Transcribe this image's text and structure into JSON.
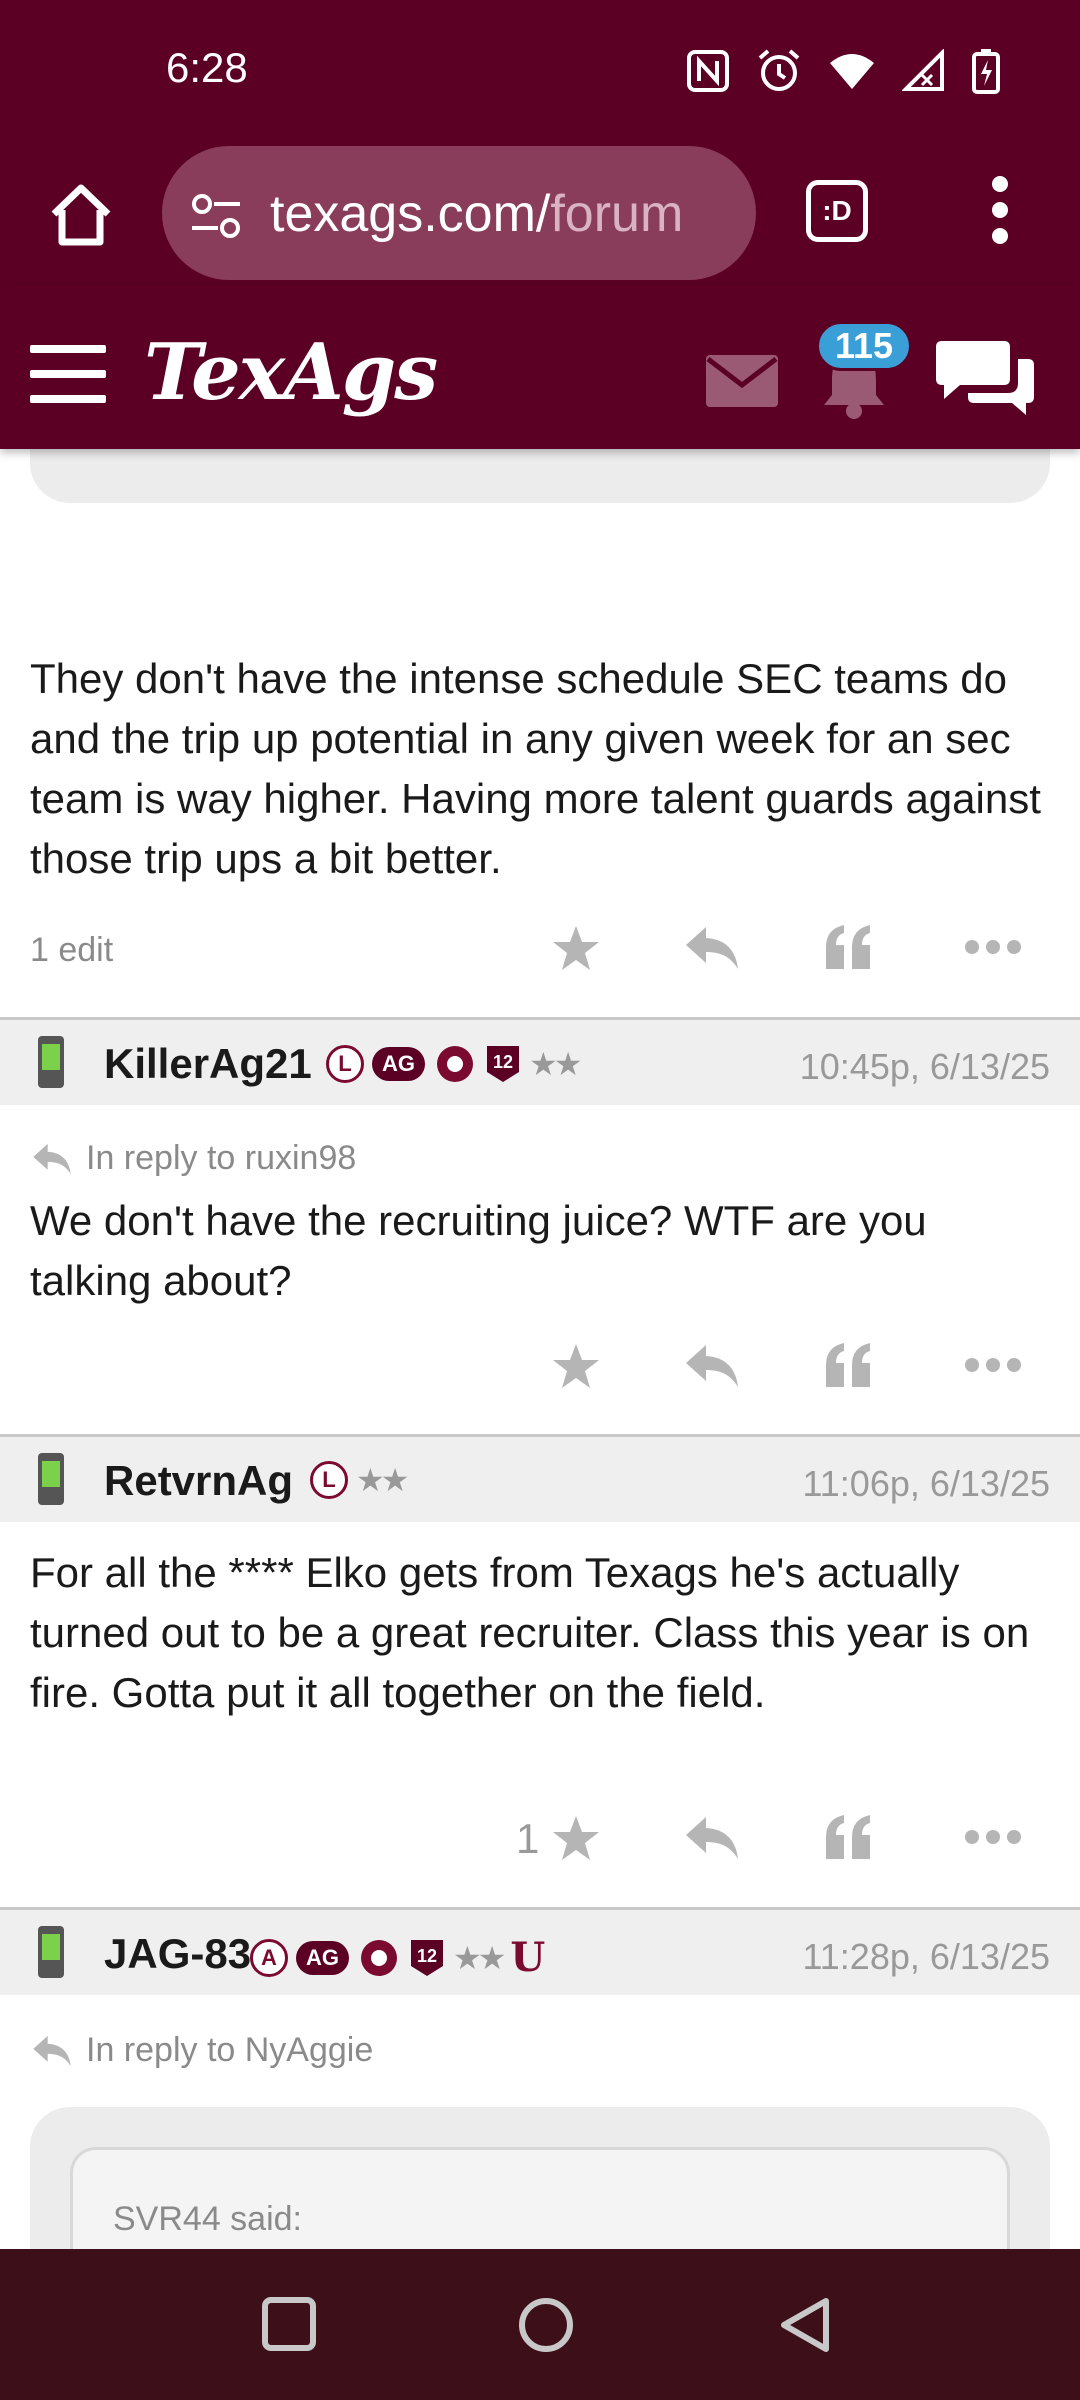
{
  "status_bar": {
    "time": "6:28",
    "icons": [
      "nfc-icon",
      "alarm-icon",
      "wifi-icon",
      "signal-icon",
      "battery-charging-icon"
    ]
  },
  "browser": {
    "url_visible": "texags.com/",
    "url_faded": "forum",
    "tab_button_label": ":D"
  },
  "site_header": {
    "logo": "TexAgs",
    "notification_count": "115"
  },
  "posts": [
    {
      "body": "They don't have the intense schedule SEC teams do and the trip up potential in any given week for an sec team is way higher. Having more talent guards against those trip ups a bit better.",
      "edit_note": "1 edit"
    },
    {
      "username": "KillerAg21",
      "badges": [
        "L",
        "AG",
        "12",
        "★★"
      ],
      "timestamp": "10:45p, 6/13/25",
      "reply_to": "In reply to ruxin98",
      "body": "We don't have the recruiting juice? WTF are you talking about?"
    },
    {
      "username": "RetvrnAg",
      "badges": [
        "L",
        "★★"
      ],
      "timestamp": "11:06p, 6/13/25",
      "body": "For all the **** Elko gets from Texags he's actually turned out to be a great recruiter. Class this year is on fire. Gotta put it all together on the field.",
      "star_count": "1"
    },
    {
      "username": "JAG-83",
      "badges": [
        "A",
        "AG",
        "12",
        "★★",
        "U"
      ],
      "timestamp": "11:28p, 6/13/25",
      "reply_to": "In reply to NyAggie",
      "quote_author": "SVR44 said:"
    }
  ],
  "colors": {
    "maroon": "#5b0024",
    "nav_bg": "#3c0f19",
    "badge_blue": "#3a9fd6",
    "muted_gray": "#999999"
  }
}
